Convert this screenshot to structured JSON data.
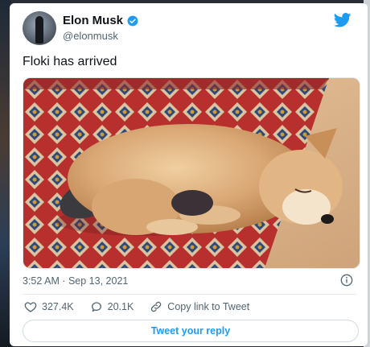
{
  "tweet": {
    "author": {
      "display_name": "Elon Musk",
      "handle": "@elonmusk",
      "verified": true
    },
    "text": "Floki has arrived",
    "media": {
      "description": "Shiba Inu puppy sleeping on a red patterned rug"
    },
    "timestamp": "3:52 AM · Sep 13, 2021",
    "stats": {
      "likes": "327.4K",
      "replies": "20.1K",
      "copy_link_label": "Copy link to Tweet"
    },
    "reply_cta": "Tweet your reply"
  },
  "colors": {
    "twitter_blue": "#1d9bf0",
    "text_primary": "#0f1419",
    "text_secondary": "#536471",
    "border": "#cfd9de"
  },
  "icons": {
    "brand": "twitter-bird-icon",
    "verified": "verified-badge-icon",
    "info": "info-icon",
    "like": "heart-icon",
    "reply": "reply-bubble-icon",
    "copy_link": "link-icon"
  }
}
